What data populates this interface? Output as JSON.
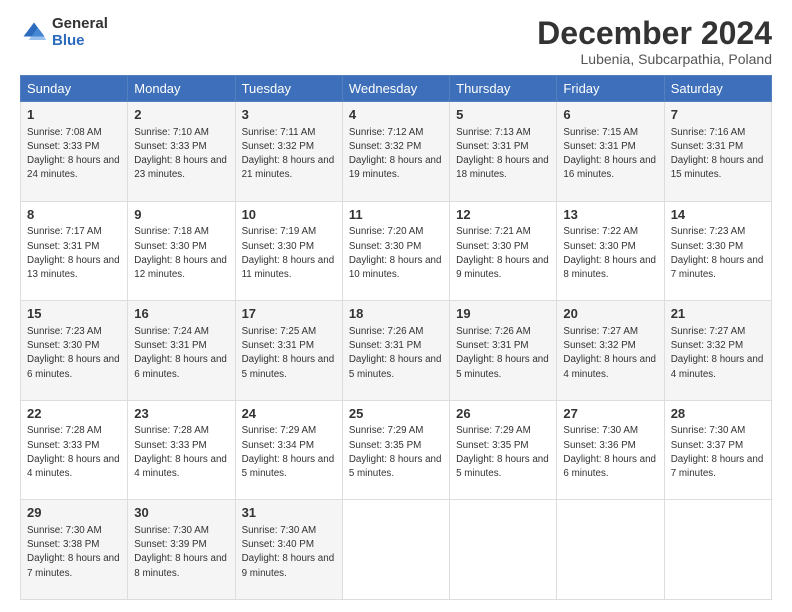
{
  "logo": {
    "general": "General",
    "blue": "Blue"
  },
  "header": {
    "month": "December 2024",
    "location": "Lubenia, Subcarpathia, Poland"
  },
  "weekdays": [
    "Sunday",
    "Monday",
    "Tuesday",
    "Wednesday",
    "Thursday",
    "Friday",
    "Saturday"
  ],
  "weeks": [
    [
      {
        "day": "1",
        "sunrise": "7:08 AM",
        "sunset": "3:33 PM",
        "daylight": "8 hours and 24 minutes."
      },
      {
        "day": "2",
        "sunrise": "7:10 AM",
        "sunset": "3:33 PM",
        "daylight": "8 hours and 23 minutes."
      },
      {
        "day": "3",
        "sunrise": "7:11 AM",
        "sunset": "3:32 PM",
        "daylight": "8 hours and 21 minutes."
      },
      {
        "day": "4",
        "sunrise": "7:12 AM",
        "sunset": "3:32 PM",
        "daylight": "8 hours and 19 minutes."
      },
      {
        "day": "5",
        "sunrise": "7:13 AM",
        "sunset": "3:31 PM",
        "daylight": "8 hours and 18 minutes."
      },
      {
        "day": "6",
        "sunrise": "7:15 AM",
        "sunset": "3:31 PM",
        "daylight": "8 hours and 16 minutes."
      },
      {
        "day": "7",
        "sunrise": "7:16 AM",
        "sunset": "3:31 PM",
        "daylight": "8 hours and 15 minutes."
      }
    ],
    [
      {
        "day": "8",
        "sunrise": "7:17 AM",
        "sunset": "3:31 PM",
        "daylight": "8 hours and 13 minutes."
      },
      {
        "day": "9",
        "sunrise": "7:18 AM",
        "sunset": "3:30 PM",
        "daylight": "8 hours and 12 minutes."
      },
      {
        "day": "10",
        "sunrise": "7:19 AM",
        "sunset": "3:30 PM",
        "daylight": "8 hours and 11 minutes."
      },
      {
        "day": "11",
        "sunrise": "7:20 AM",
        "sunset": "3:30 PM",
        "daylight": "8 hours and 10 minutes."
      },
      {
        "day": "12",
        "sunrise": "7:21 AM",
        "sunset": "3:30 PM",
        "daylight": "8 hours and 9 minutes."
      },
      {
        "day": "13",
        "sunrise": "7:22 AM",
        "sunset": "3:30 PM",
        "daylight": "8 hours and 8 minutes."
      },
      {
        "day": "14",
        "sunrise": "7:23 AM",
        "sunset": "3:30 PM",
        "daylight": "8 hours and 7 minutes."
      }
    ],
    [
      {
        "day": "15",
        "sunrise": "7:23 AM",
        "sunset": "3:30 PM",
        "daylight": "8 hours and 6 minutes."
      },
      {
        "day": "16",
        "sunrise": "7:24 AM",
        "sunset": "3:31 PM",
        "daylight": "8 hours and 6 minutes."
      },
      {
        "day": "17",
        "sunrise": "7:25 AM",
        "sunset": "3:31 PM",
        "daylight": "8 hours and 5 minutes."
      },
      {
        "day": "18",
        "sunrise": "7:26 AM",
        "sunset": "3:31 PM",
        "daylight": "8 hours and 5 minutes."
      },
      {
        "day": "19",
        "sunrise": "7:26 AM",
        "sunset": "3:31 PM",
        "daylight": "8 hours and 5 minutes."
      },
      {
        "day": "20",
        "sunrise": "7:27 AM",
        "sunset": "3:32 PM",
        "daylight": "8 hours and 4 minutes."
      },
      {
        "day": "21",
        "sunrise": "7:27 AM",
        "sunset": "3:32 PM",
        "daylight": "8 hours and 4 minutes."
      }
    ],
    [
      {
        "day": "22",
        "sunrise": "7:28 AM",
        "sunset": "3:33 PM",
        "daylight": "8 hours and 4 minutes."
      },
      {
        "day": "23",
        "sunrise": "7:28 AM",
        "sunset": "3:33 PM",
        "daylight": "8 hours and 4 minutes."
      },
      {
        "day": "24",
        "sunrise": "7:29 AM",
        "sunset": "3:34 PM",
        "daylight": "8 hours and 5 minutes."
      },
      {
        "day": "25",
        "sunrise": "7:29 AM",
        "sunset": "3:35 PM",
        "daylight": "8 hours and 5 minutes."
      },
      {
        "day": "26",
        "sunrise": "7:29 AM",
        "sunset": "3:35 PM",
        "daylight": "8 hours and 5 minutes."
      },
      {
        "day": "27",
        "sunrise": "7:30 AM",
        "sunset": "3:36 PM",
        "daylight": "8 hours and 6 minutes."
      },
      {
        "day": "28",
        "sunrise": "7:30 AM",
        "sunset": "3:37 PM",
        "daylight": "8 hours and 7 minutes."
      }
    ],
    [
      {
        "day": "29",
        "sunrise": "7:30 AM",
        "sunset": "3:38 PM",
        "daylight": "8 hours and 7 minutes."
      },
      {
        "day": "30",
        "sunrise": "7:30 AM",
        "sunset": "3:39 PM",
        "daylight": "8 hours and 8 minutes."
      },
      {
        "day": "31",
        "sunrise": "7:30 AM",
        "sunset": "3:40 PM",
        "daylight": "8 hours and 9 minutes."
      },
      null,
      null,
      null,
      null
    ]
  ]
}
